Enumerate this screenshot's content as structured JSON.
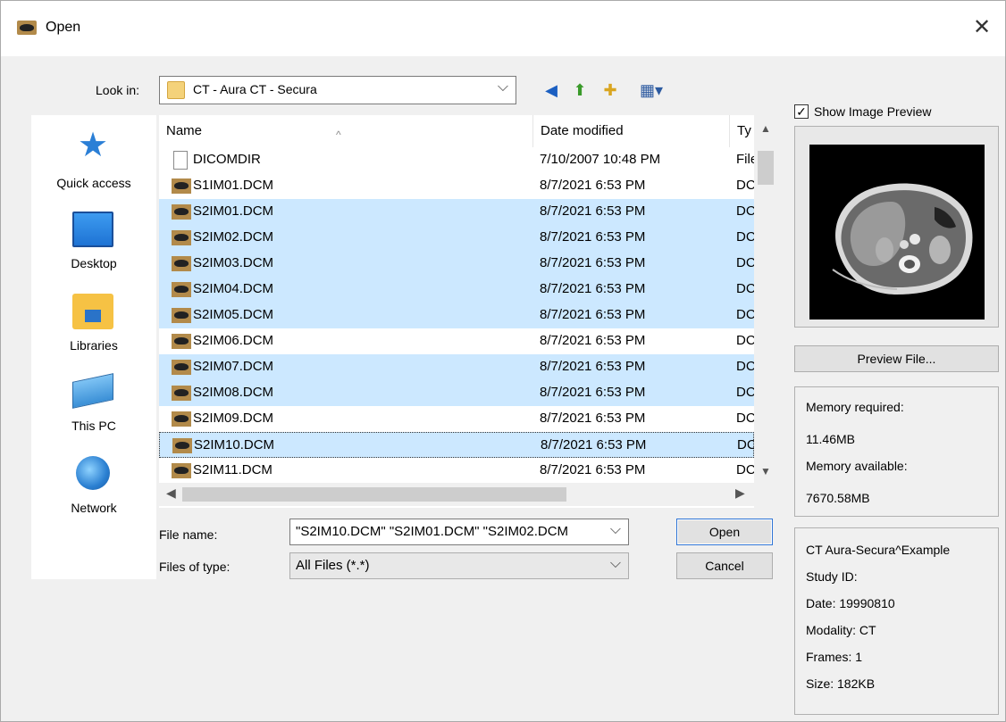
{
  "window": {
    "title": "Open",
    "close_label": "✕"
  },
  "toolbar": {
    "look_in_label": "Look in:",
    "look_in_value": "CT - Aura  CT - Secura",
    "combo_arrow": "⌵",
    "back_glyph": "◀",
    "up_glyph": "⬆",
    "new_folder_glyph": "✚",
    "views_glyph": "▦▾"
  },
  "places": [
    {
      "label": "Quick access"
    },
    {
      "label": "Desktop"
    },
    {
      "label": "Libraries"
    },
    {
      "label": "This PC"
    },
    {
      "label": "Network"
    }
  ],
  "file_list": {
    "columns": {
      "name": "Name",
      "date": "Date modified",
      "type": "Ty"
    },
    "sort_arrow": "^",
    "rows": [
      {
        "name": "DICOMDIR",
        "date": "7/10/2007 10:48 PM",
        "type": "File",
        "selected": false
      },
      {
        "name": "S1IM01.DCM",
        "date": "8/7/2021 6:53 PM",
        "type": "DCM",
        "selected": false
      },
      {
        "name": "S2IM01.DCM",
        "date": "8/7/2021 6:53 PM",
        "type": "DCM",
        "selected": true
      },
      {
        "name": "S2IM02.DCM",
        "date": "8/7/2021 6:53 PM",
        "type": "DCM",
        "selected": true
      },
      {
        "name": "S2IM03.DCM",
        "date": "8/7/2021 6:53 PM",
        "type": "DCM",
        "selected": true
      },
      {
        "name": "S2IM04.DCM",
        "date": "8/7/2021 6:53 PM",
        "type": "DCM",
        "selected": true
      },
      {
        "name": "S2IM05.DCM",
        "date": "8/7/2021 6:53 PM",
        "type": "DCM",
        "selected": true
      },
      {
        "name": "S2IM06.DCM",
        "date": "8/7/2021 6:53 PM",
        "type": "DCM",
        "selected": false
      },
      {
        "name": "S2IM07.DCM",
        "date": "8/7/2021 6:53 PM",
        "type": "DCM",
        "selected": true
      },
      {
        "name": "S2IM08.DCM",
        "date": "8/7/2021 6:53 PM",
        "type": "DCM",
        "selected": true
      },
      {
        "name": "S2IM09.DCM",
        "date": "8/7/2021 6:53 PM",
        "type": "DCM",
        "selected": false
      },
      {
        "name": "S2IM10.DCM",
        "date": "8/7/2021 6:53 PM",
        "type": "DCM",
        "selected": true,
        "focused": true
      },
      {
        "name": "S2IM11.DCM",
        "date": "8/7/2021 6:53 PM",
        "type": "DCM",
        "selected": false
      }
    ]
  },
  "form": {
    "file_name_label": "File name:",
    "file_name_value": "\"S2IM10.DCM\" \"S2IM01.DCM\" \"S2IM02.DCM",
    "files_of_type_label": "Files of type:",
    "files_of_type_value": "All Files (*.*)",
    "open_label": "Open",
    "cancel_label": "Cancel"
  },
  "preview": {
    "show_preview_label": "Show Image Preview",
    "show_preview_checked": true,
    "check_glyph": "✓",
    "preview_button": "Preview File...",
    "memory_required_label": "Memory required:",
    "memory_required_value": "11.46MB",
    "memory_available_label": "Memory available:",
    "memory_available_value": "7670.58MB"
  },
  "study_info": {
    "patient": "CT Aura-Secura^Example",
    "study_id": "Study ID:",
    "date": "Date: 19990810",
    "modality": "Modality: CT",
    "frames": "Frames: 1",
    "size": "Size: 182KB"
  },
  "colors": {
    "selection": "#cce8ff",
    "folder": "#f4d27a",
    "accent": "#2f75d6"
  }
}
